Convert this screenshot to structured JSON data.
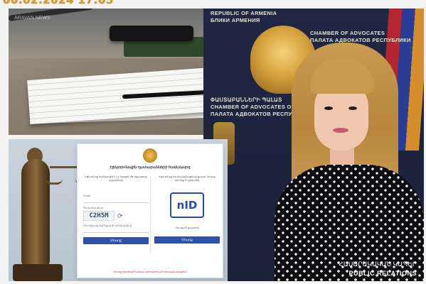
{
  "banner": {
    "date": "06.02.2024 17:05"
  },
  "desk_panel": {
    "watermark": "ARAVAN NEWS"
  },
  "login_screen": {
    "title": "Էլեկտրոնային դատարանների համակարգ",
    "left_column": {
      "intro": "Եթե ունեք ծածկագիր և էլ. հասցե, մուտքագրեք տվյալները",
      "email_label": "Email",
      "password_label": "Գաղտնաբառ",
      "captcha_text": "C2H5M",
      "captcha_label": "Մուտքագրեք նկարի սիմվոլները",
      "submit_label": "Մուտք"
    },
    "right_column": {
      "intro": "Եթե ունեք նույնականացման քարտ, մուտք գործեք ID քարտով",
      "logo_text": "nID",
      "hint": "Մուտք ID քարտով",
      "submit_label": "Մուտք"
    },
    "footer": "Մուտք գործելու համար անհրաժեշտ է նույնականացում"
  },
  "portrait_panel": {
    "wall_lines": [
      "REPUBLIC OF ARMENIA",
      "БЛИКИ АРМЕНИЯ",
      "CHAMBER OF ADVOCATES",
      "ПАЛАТА АДВОКАТОВ РЕСПУБЛИКИ",
      "ՓԱՍՏԱԲԱՆՆԵՐԻ ՊԱԼԱՏ",
      "CHAMBER OF ADVOCATES OF THE R",
      "ПАЛАТА АДВОКАТОВ РЕСПУ"
    ],
    "caption_armenian": "ՀԱՍԱՐԱԿԱԿԱՆ ԿԱՊԵՐ",
    "caption_english": "PUBLIC RELATIONS"
  },
  "colors": {
    "banner": "#d89a2c",
    "login_button": "#2f52a8",
    "portrait_background": "#1f2744",
    "nid_logo": "#2a4c9f"
  }
}
